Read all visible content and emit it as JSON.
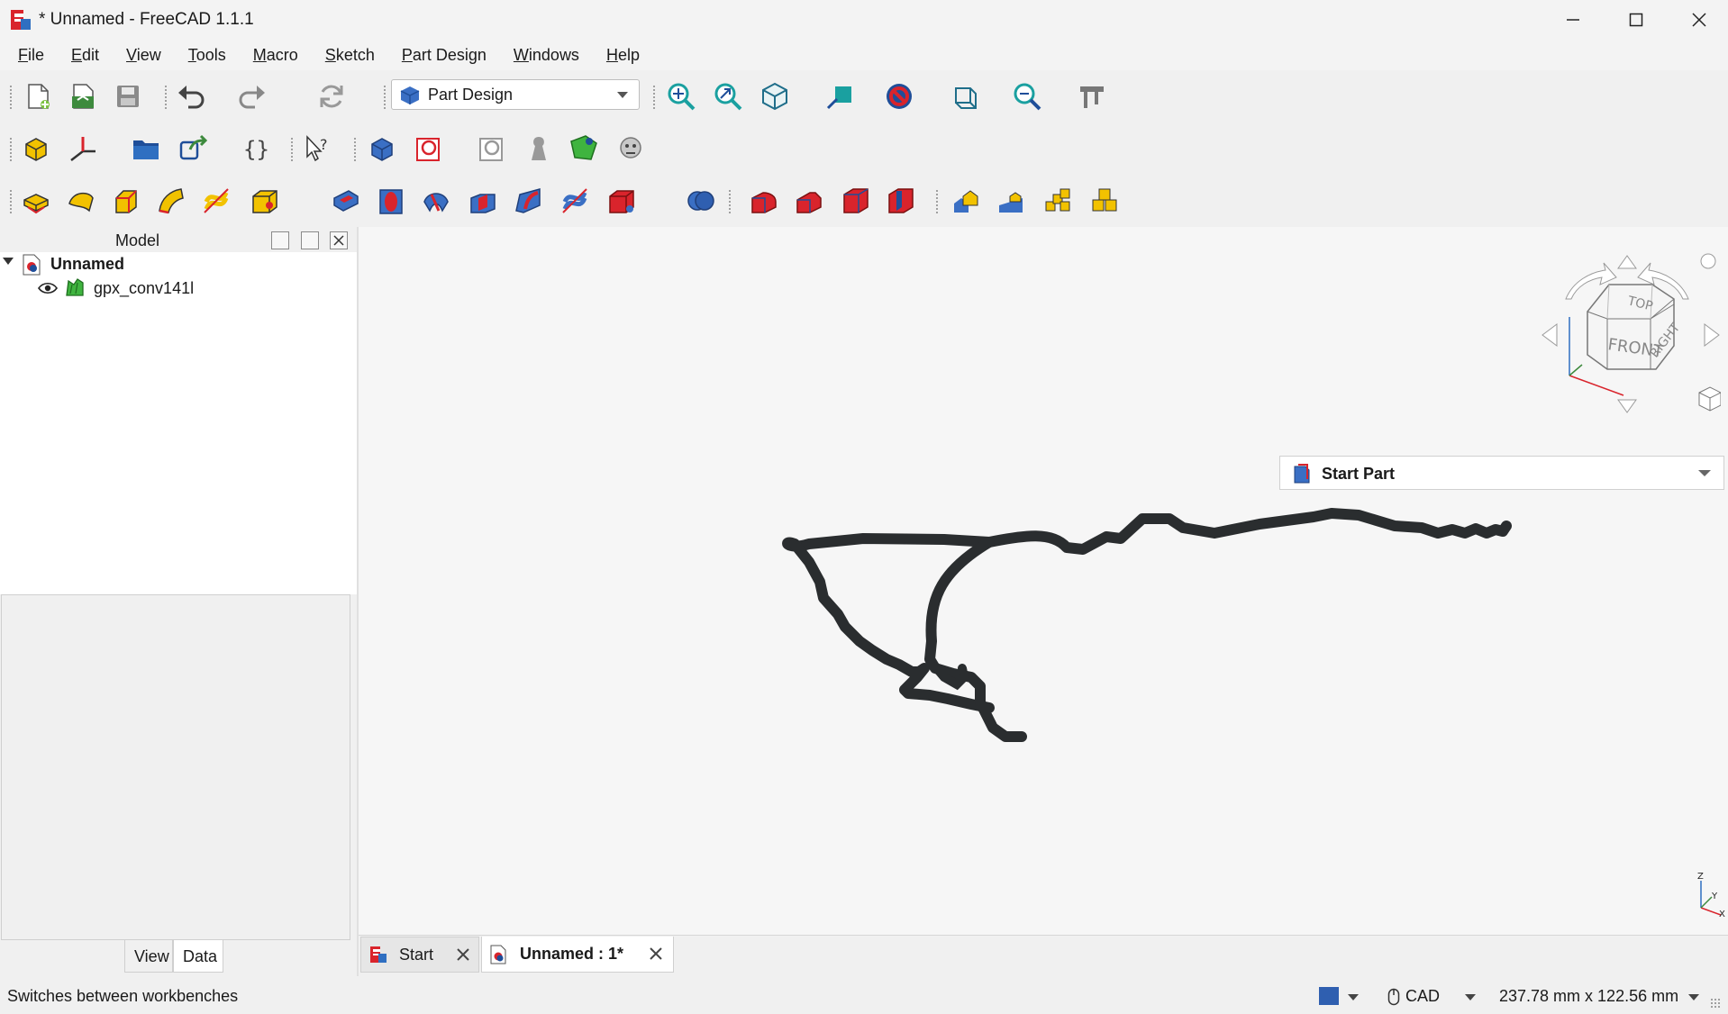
{
  "window": {
    "title": "* Unnamed - FreeCAD 1.1.1",
    "app_icon": "freecad-logo-icon",
    "controls": [
      "minimize-icon",
      "maximize-icon",
      "close-icon"
    ]
  },
  "menu": [
    {
      "label": "File",
      "mnemonic": "F"
    },
    {
      "label": "Edit",
      "mnemonic": "E"
    },
    {
      "label": "View",
      "mnemonic": "V"
    },
    {
      "label": "Tools",
      "mnemonic": "T"
    },
    {
      "label": "Macro",
      "mnemonic": "M"
    },
    {
      "label": "Sketch",
      "mnemonic": "S"
    },
    {
      "label": "Part Design",
      "mnemonic": "P"
    },
    {
      "label": "Windows",
      "mnemonic": "W"
    },
    {
      "label": "Help",
      "mnemonic": "H"
    }
  ],
  "workbench": {
    "selected": "Part Design",
    "icon": "part-design-icon"
  },
  "toolbars": {
    "file": [
      "new-document-icon",
      "open-document-icon",
      "save-icon",
      "undo-icon",
      "redo-icon",
      "refresh-icon"
    ],
    "view": [
      "fit-all-icon",
      "fit-selection-icon",
      "standard-views-icon",
      "measure-icon",
      "draw-style-icon",
      "bounding-box-icon",
      "zoom-icon",
      "measure-caliper-icon"
    ],
    "structure": [
      "create-part-icon",
      "datum-line-icon",
      "create-group-icon",
      "link-icon",
      "variable-set-icon",
      "whats-this-icon",
      "create-body-icon",
      "create-sketch-icon",
      "validate-sketch-icon",
      "shape-binder-icon",
      "subshape-binder-icon",
      "clone-icon"
    ],
    "features": [
      "pad-icon",
      "revolution-icon",
      "additive-loft-icon",
      "additive-pipe-icon",
      "additive-helix-icon",
      "additive-primitive-icon",
      "pocket-icon",
      "hole-icon",
      "groove-icon",
      "subtractive-loft-icon",
      "subtractive-pipe-icon",
      "subtractive-helix-icon",
      "subtractive-primitive-icon",
      "boolean-icon",
      "fillet-icon",
      "chamfer-icon",
      "draft-icon",
      "thickness-icon",
      "mirrored-icon",
      "linear-pattern-icon",
      "polar-pattern-icon",
      "multi-transform-icon"
    ]
  },
  "model_panel": {
    "title": "Model",
    "tree": [
      {
        "label": "Unnamed",
        "icon": "document-icon",
        "expanded": true,
        "bold": true
      },
      {
        "label": "gpx_conv141l",
        "icon": "gpx-shape-icon",
        "visible_icon": "eye-icon"
      }
    ],
    "tabs": [
      {
        "label": "View",
        "active": false
      },
      {
        "label": "Data",
        "active": true
      }
    ]
  },
  "viewport": {
    "start_part_label": "Start Part",
    "navcube": {
      "top": "TOP",
      "front": "FRONT",
      "right": "RIGHT"
    },
    "axis": {
      "z": "Z",
      "y": "Y",
      "x": "X"
    }
  },
  "doc_tabs": [
    {
      "label": "Start",
      "icon": "freecad-logo-icon",
      "active": false
    },
    {
      "label": "Unnamed : 1*",
      "icon": "document-icon",
      "active": true
    }
  ],
  "status": {
    "message": "Switches between workbenches",
    "nav_style": "CAD",
    "dimensions": "237.78 mm x 122.56 mm"
  },
  "colors": {
    "accent_blue": "#1f4e99",
    "feature_red": "#cc1f1f",
    "feature_yellow": "#f2c200",
    "highlight_teal": "#1aa0a0",
    "track": "#2a2d2f"
  }
}
